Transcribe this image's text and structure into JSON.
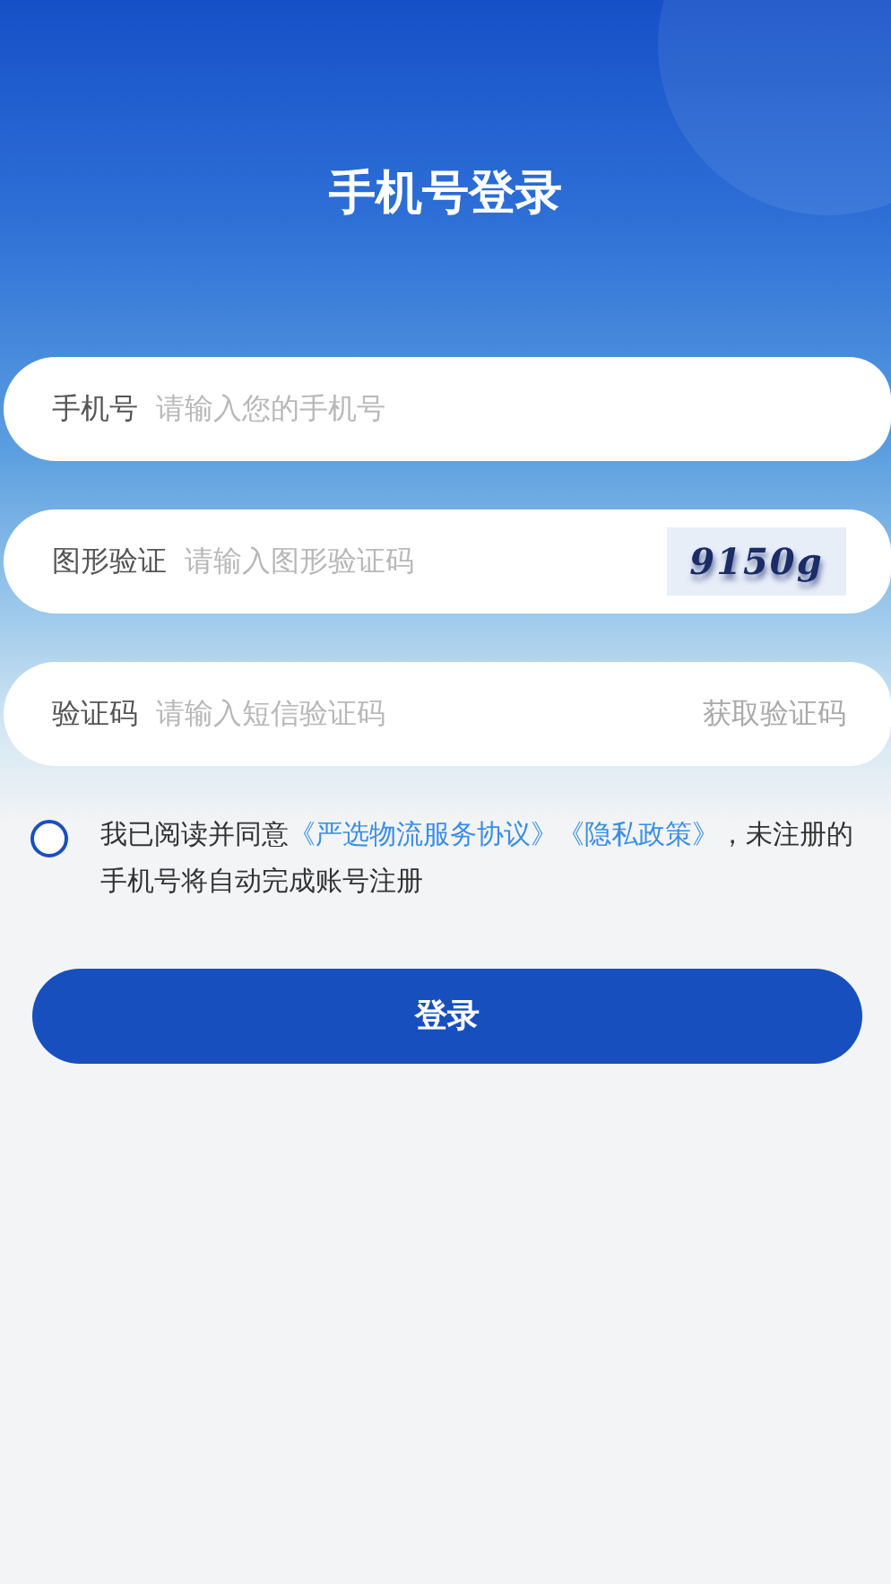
{
  "title": "手机号登录",
  "fields": [
    {
      "kind": "text",
      "label": "手机号",
      "placeholder": "请输入您的手机号"
    },
    {
      "kind": "captcha",
      "label": "图形验证",
      "placeholder": "请输入图形验证码",
      "captcha": "9150g"
    },
    {
      "kind": "sms",
      "label": "验证码",
      "placeholder": "请输入短信验证码",
      "action": "获取验证码"
    }
  ],
  "agreement": {
    "checked": false,
    "prefix": "我已阅读并同意",
    "links": [
      "《严选物流服务协议》",
      "《隐私政策》"
    ],
    "suffix": "，未注册的手机号将自动完成账号注册"
  },
  "login_button": "登录"
}
